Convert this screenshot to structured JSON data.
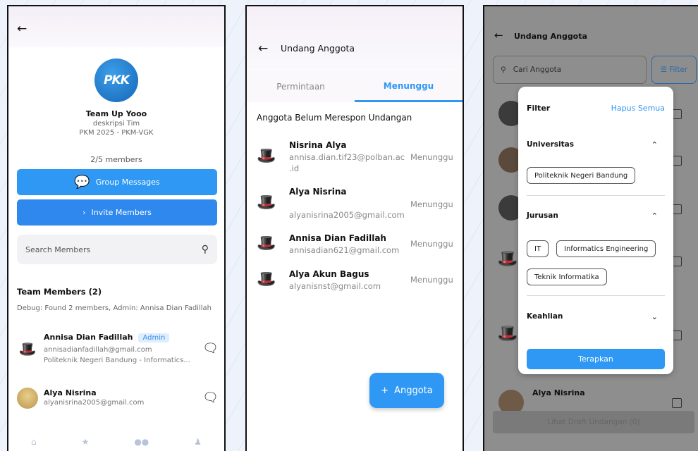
{
  "screen1": {
    "team_name": "Team Up Yooo",
    "team_desc": "deskripsi Tim",
    "team_program": "PKM 2025 - PKM-VGK",
    "member_count": "2/5 members",
    "logo_text": "PKK",
    "group_button": "Group Messages",
    "invite_button": "Invite Members",
    "search_placeholder": "Search Members",
    "members_title": "Team Members (2)",
    "debug_text": "Debug: Found 2 members, Admin: Annisa Dian Fadillah",
    "members": [
      {
        "name": "Annisa Dian Fadillah",
        "badge": "Admin",
        "email": "annisadianfadillah@gmail.com",
        "info": "Politeknik Negeri Bandung - Informatics..."
      },
      {
        "name": "Alya Nisrina",
        "email": "alyanisrina2005@gmail.com"
      }
    ]
  },
  "screen2": {
    "title": "Undang Anggota",
    "tabs": [
      "Permintaan",
      "Menunggu"
    ],
    "section_title": "Anggota Belum Merespon Undangan",
    "invites": [
      {
        "name": "Nisrina Alya",
        "email_line1": "annisa.dian.tif23@polban.ac",
        "email_line2": ".id",
        "status": "Menunggu"
      },
      {
        "name": "Alya Nisrina",
        "email": "alyanisrina2005@gmail.com",
        "status": "Menunggu"
      },
      {
        "name": "Annisa Dian Fadillah",
        "email": "annisadian621@gmail.com",
        "status": "Menunggu"
      },
      {
        "name": "Alya Akun Bagus",
        "email": "alyanisnst@gmail.com",
        "status": "Menunggu"
      }
    ],
    "fab_label": "Anggota"
  },
  "screen3": {
    "title": "Undang Anggota",
    "search_placeholder": "Cari Anggota",
    "filter_button": "Filter",
    "partial_member_name": "Alya Nisrina",
    "draft_button": "Lihat Draft Undangan (0)",
    "filter_panel": {
      "title": "Filter",
      "clear_all": "Hapus Semua",
      "universitas_label": "Universitas",
      "universitas_chips": [
        "Politeknik Negeri Bandung"
      ],
      "jurusan_label": "Jurusan",
      "jurusan_chips": [
        "IT",
        "Informatics Engineering",
        "Teknik Informatika"
      ],
      "keahlian_label": "Keahlian",
      "apply_button": "Terapkan"
    }
  },
  "colors": {
    "primary": "#2f98f4",
    "overlay_gray": "#8e8e8e"
  }
}
